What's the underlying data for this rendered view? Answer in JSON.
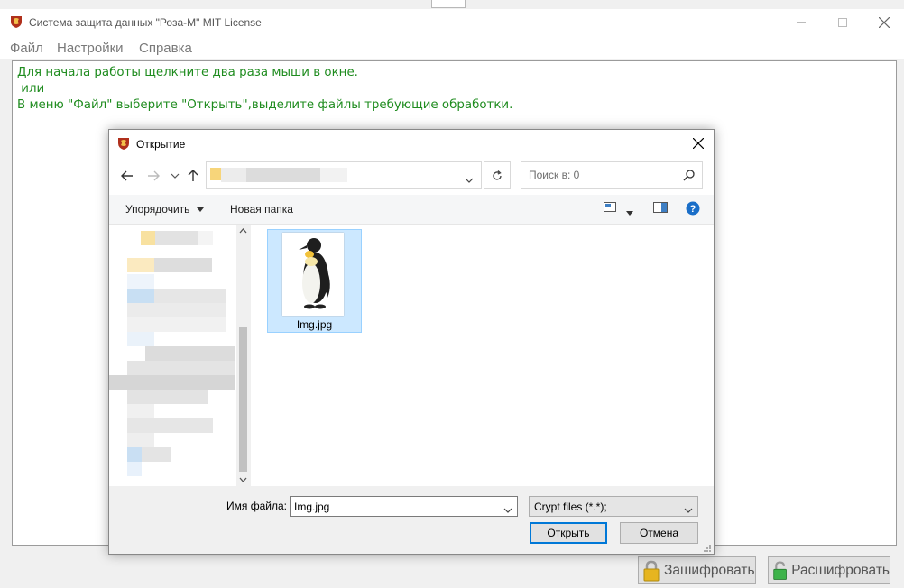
{
  "app": {
    "title": "Система защита данных \"Роза-М\" MIT License",
    "icon": "rose-shield-icon"
  },
  "menu": {
    "items": [
      "Файл",
      "Настройки",
      "Справка"
    ]
  },
  "main": {
    "hint_lines": [
      "Для начала работы щелкните два раза мыши в окне.",
      " или",
      "В меню \"Файл\" выберите \"Открыть\",выделите файлы требующие обработки."
    ],
    "hint_color": "#1f8c1f"
  },
  "buttons": {
    "encrypt": "Зашифровать",
    "decrypt": "Расшифровать"
  },
  "dialog": {
    "title": "Открытие",
    "search_placeholder": "Поиск в: 0",
    "toolbar": {
      "organize": "Упорядочить",
      "new_folder": "Новая папка"
    },
    "files": [
      {
        "name": "Img.jpg",
        "selected": true,
        "thumbnail": "penguin"
      }
    ],
    "filename_label": "Имя файла:",
    "filename_value": "Img.jpg",
    "filter_value": "Crypt files (*.*);",
    "open_label": "Открыть",
    "cancel_label": "Отмена"
  },
  "colors": {
    "accent": "#0078d7",
    "selection_bg": "#cce8ff",
    "selection_border": "#99d1ff",
    "help_icon": "#1a6ec8"
  }
}
